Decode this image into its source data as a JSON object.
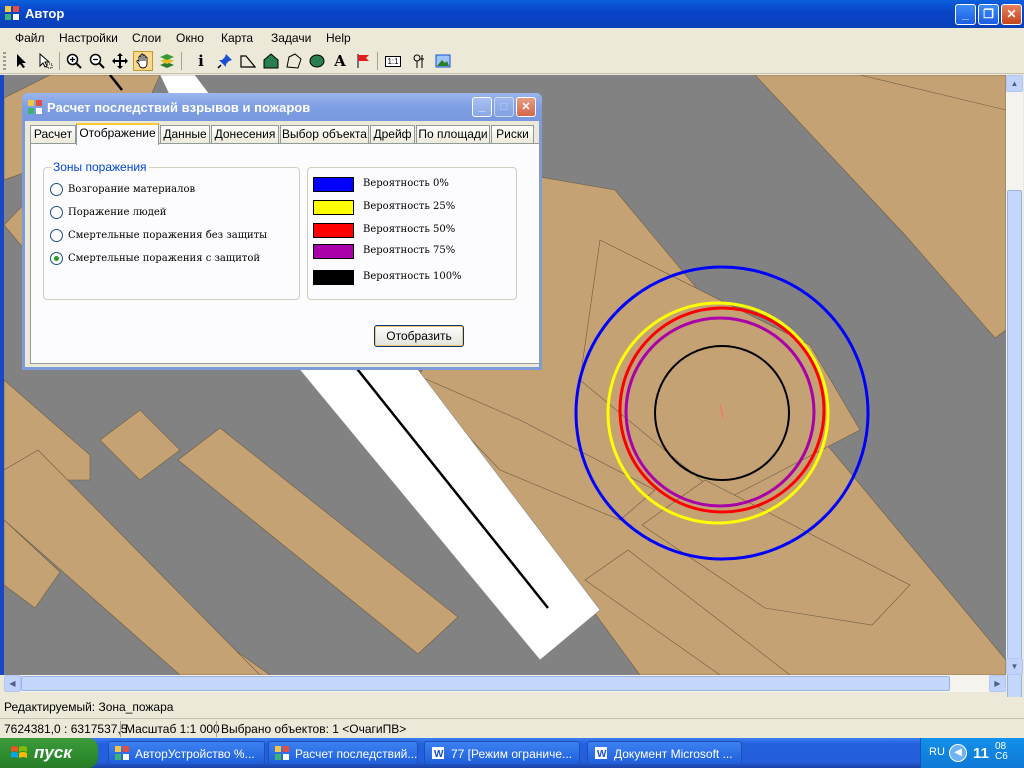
{
  "window": {
    "title": "Автор",
    "buttons": [
      "_",
      "❐",
      "✕"
    ]
  },
  "menu": [
    "Файл",
    "Настройки",
    "Слои",
    "Окно",
    "Карта",
    "Задачи",
    "Help"
  ],
  "toolbar": {
    "tools": [
      "select-arrow-icon",
      "select-cursor-icon",
      "zoom-in-icon",
      "zoom-out-icon",
      "pan-move-icon",
      "hand-icon",
      "layers-icon",
      "info-icon",
      "pin-icon",
      "polyline-icon",
      "polygon-icon",
      "shape-icon",
      "ellipse-icon",
      "text-icon",
      "flag-icon",
      "scale-icon",
      "tool-icon",
      "image-icon"
    ],
    "active_tool": "hand-icon",
    "text_icon_glyph": "A",
    "info_icon_glyph": "i",
    "scale_icon_glyph": "1:1"
  },
  "dialog": {
    "title": "Расчет последствий взрывов и пожаров",
    "tabs": [
      "Расчет",
      "Отображение",
      "Данные",
      "Донесения",
      "Выбор объекта",
      "Дрейф",
      "По площади",
      "Риски"
    ],
    "active_tab": "Отображение",
    "zones_group": {
      "legend": "Зоны поражения",
      "options": [
        {
          "label": "Возгорание материалов",
          "checked": false
        },
        {
          "label": "Поражение людей",
          "checked": false
        },
        {
          "label": "Смертельные поражения без защиты",
          "checked": false
        },
        {
          "label": "Смертельные поражения с защитой",
          "checked": true
        }
      ]
    },
    "probability_legend": [
      {
        "color": "#0000ff",
        "label": "Вероятность 0%"
      },
      {
        "color": "#ffff00",
        "label": "Вероятность 25%"
      },
      {
        "color": "#ff0000",
        "label": "Вероятность 50%"
      },
      {
        "color": "#aa00aa",
        "label": "Вероятность 75%"
      },
      {
        "color": "#000000",
        "label": "Вероятность 100%"
      }
    ],
    "show_button": "Отобразить"
  },
  "colors": {
    "map_background": "#828282",
    "building": "#c4a274",
    "road": "#ffffff"
  },
  "status": {
    "editable": "Редактируемый: Зона_пожара",
    "coords": "7624381,0 : 6317537,5",
    "scale": "Масштаб 1:1 000",
    "selected": "Выбрано объектов: 1 <ОчагиПВ>"
  },
  "taskbar": {
    "start": "пуск",
    "tasks": [
      {
        "label": "АвторУстройство %...",
        "active": false
      },
      {
        "label": "Расчет последствий...",
        "active": false
      },
      {
        "label": "77 [Режим ограниче...",
        "active": false
      },
      {
        "label": "Документ Microsoft ...",
        "active": false
      }
    ],
    "lang": "RU",
    "clock_hour": "11",
    "clock_min1": "08",
    "clock_min2": "С6"
  }
}
